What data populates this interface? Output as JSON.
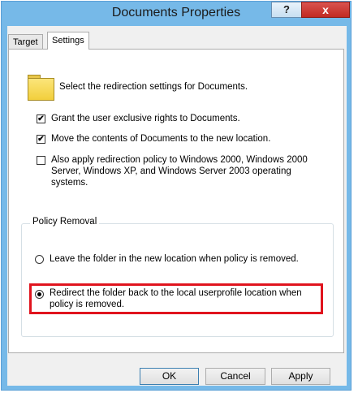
{
  "window": {
    "title": "Documents Properties",
    "help_label": "?",
    "close_label": "x"
  },
  "tabs": [
    {
      "label": "Target",
      "selected": false
    },
    {
      "label": "Settings",
      "selected": true
    }
  ],
  "settings": {
    "description": "Select the redirection settings for Documents.",
    "folder_icon": "folder-icon",
    "checkboxes": [
      {
        "lines": [
          "Grant the user exclusive rights to Documents."
        ],
        "checked": true
      },
      {
        "lines": [
          "Move the contents of Documents to the new location."
        ],
        "checked": true
      },
      {
        "lines": [
          "Also apply redirection policy to Windows 2000, Windows 2000",
          "Server, Windows XP, and Windows Server 2003 operating",
          "systems."
        ],
        "checked": false
      }
    ],
    "policy_removal": {
      "legend": "Policy Removal",
      "options": [
        {
          "lines": [
            "Leave the folder in the new location when policy is removed."
          ],
          "selected": false
        },
        {
          "lines": [
            "Redirect the folder back to the local userprofile location when",
            "policy is removed."
          ],
          "selected": true
        }
      ]
    },
    "highlight_color": "#e0141e"
  },
  "buttons": {
    "ok": "OK",
    "cancel": "Cancel",
    "apply": "Apply"
  },
  "colors": {
    "title_bar": "#76b9e8",
    "close_button": "#c7302a"
  }
}
